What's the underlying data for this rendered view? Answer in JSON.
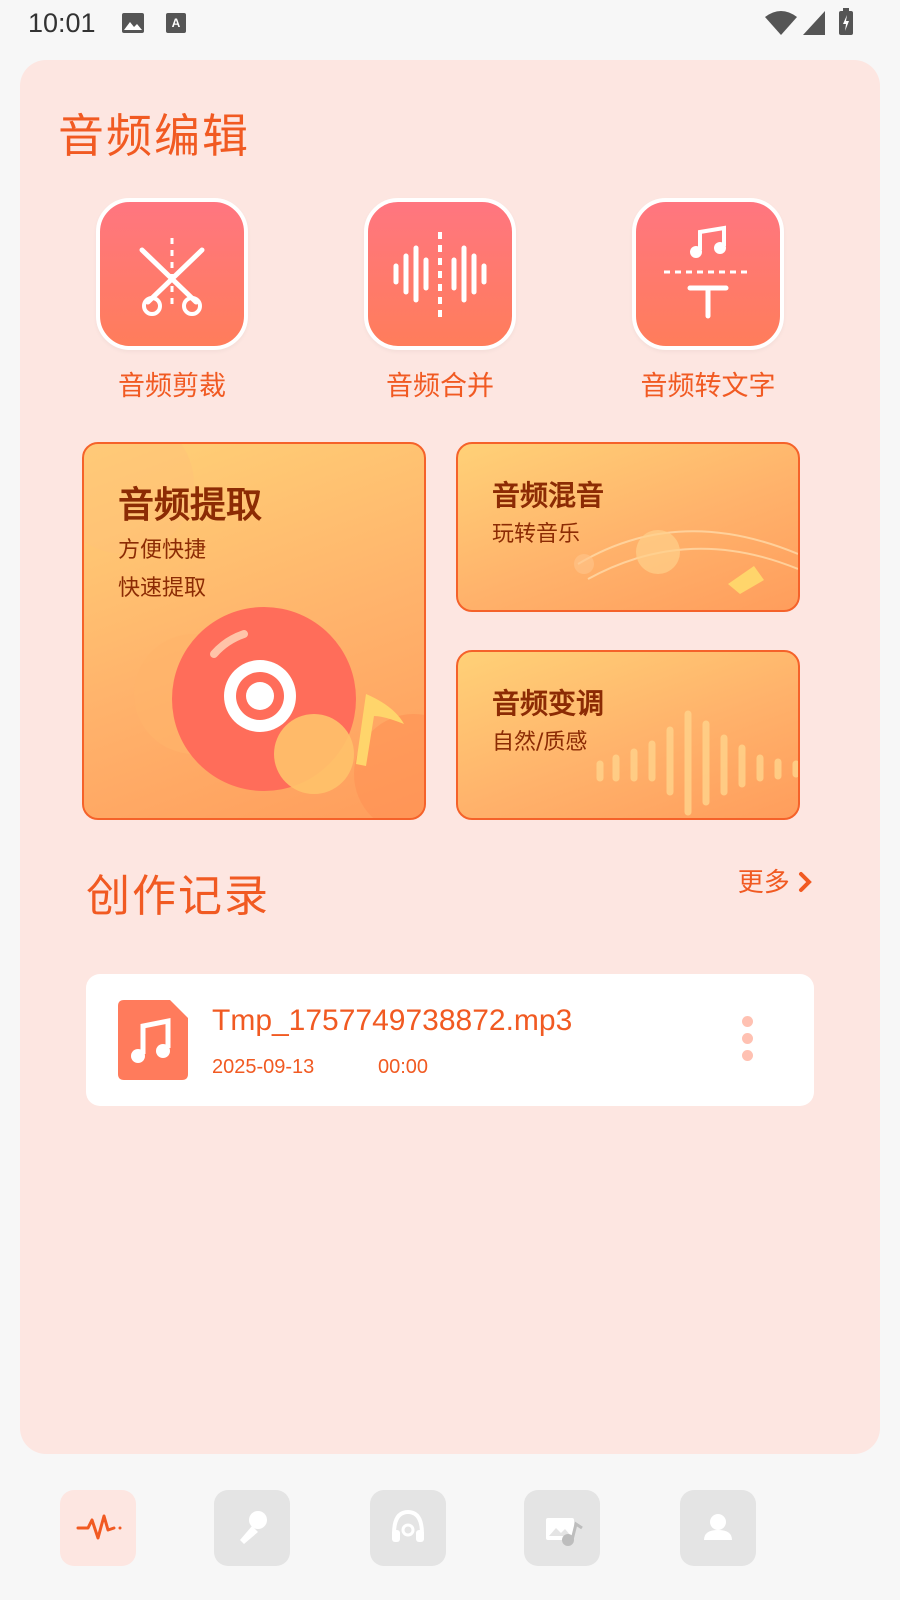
{
  "status_bar": {
    "time": "10:01"
  },
  "audio_edit": {
    "title": "音频编辑",
    "tools": [
      {
        "label": "音频剪裁",
        "icon": "scissors-icon"
      },
      {
        "label": "音频合并",
        "icon": "waveform-icon"
      },
      {
        "label": "音频转文字",
        "icon": "music-to-text-icon"
      }
    ],
    "cards": {
      "extract": {
        "title": "音频提取",
        "line1": "方便快捷",
        "line2": "快速提取"
      },
      "mix": {
        "title": "音频混音",
        "sub": "玩转音乐"
      },
      "pitch": {
        "title": "音频变调",
        "sub": "自然/质感"
      }
    }
  },
  "records": {
    "title": "创作记录",
    "more": "更多",
    "items": [
      {
        "name": "Tmp_1757749738872.mp3",
        "date": "2025-09-13",
        "duration": "00:00"
      }
    ]
  },
  "tabbar": {
    "tabs": [
      "waveform-icon",
      "microphone-icon",
      "headphones-icon",
      "image-music-icon",
      "person-icon"
    ],
    "active_index": 0
  },
  "colors": {
    "accent": "#f15a22",
    "panel": "#fde6e1",
    "card_text": "#8c2b04"
  }
}
